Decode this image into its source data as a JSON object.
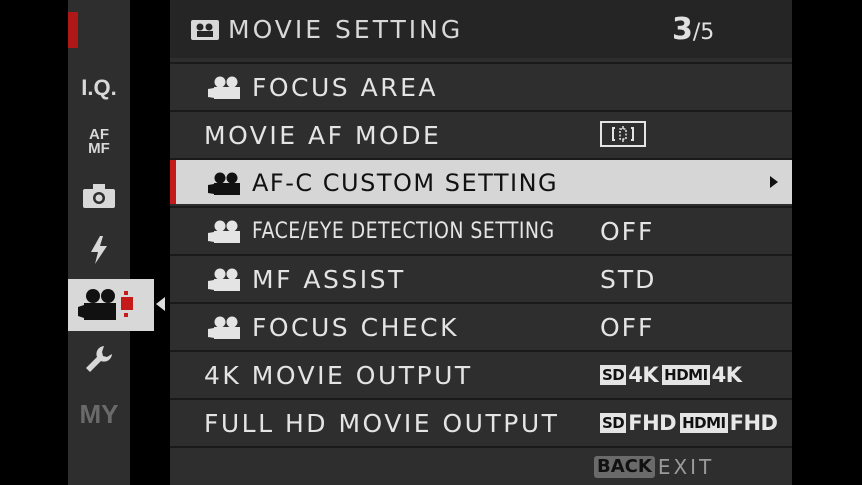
{
  "header": {
    "title": "MOVIE SETTING",
    "page_current": "3",
    "page_sep": "/",
    "page_total": "5"
  },
  "sidebar": {
    "items": [
      {
        "label": "I.Q.",
        "icon": "image-quality-icon"
      },
      {
        "label": "AF MF",
        "icon": "af-mf-icon"
      },
      {
        "label": "",
        "icon": "camera-icon"
      },
      {
        "label": "",
        "icon": "flash-icon"
      },
      {
        "label": "",
        "icon": "movie-camera-icon",
        "active": true
      },
      {
        "label": "",
        "icon": "wrench-icon"
      },
      {
        "label": "MY",
        "icon": "my-menu-icon"
      }
    ]
  },
  "menu": {
    "rows": [
      {
        "label": "FOCUS AREA",
        "value": ""
      },
      {
        "label": "MOVIE AF MODE",
        "value": ""
      },
      {
        "label": "AF-C CUSTOM SETTING",
        "value": ""
      },
      {
        "label": "FACE/EYE DETECTION SETTING",
        "value": "OFF"
      },
      {
        "label": "MF ASSIST",
        "value": "STD"
      },
      {
        "label": "FOCUS CHECK",
        "value": "OFF"
      },
      {
        "label": "4K MOVIE OUTPUT",
        "value": ""
      },
      {
        "label": "FULL HD MOVIE OUTPUT",
        "value": ""
      }
    ],
    "output_4k": {
      "sd_badge": "SD",
      "sd_value": "4K",
      "hdmi_badge": "HDMI",
      "hdmi_value": "4K"
    },
    "output_fhd": {
      "sd_badge": "SD",
      "sd_value": "FHD",
      "hdmi_badge": "HDMI",
      "hdmi_value": "FHD"
    }
  },
  "footer": {
    "back_label": "BACK",
    "exit_label": "EXIT"
  },
  "colors": {
    "selection_accent": "#c41a1a",
    "panel": "#2e2e2e",
    "selected_row": "#d6d6d6"
  }
}
